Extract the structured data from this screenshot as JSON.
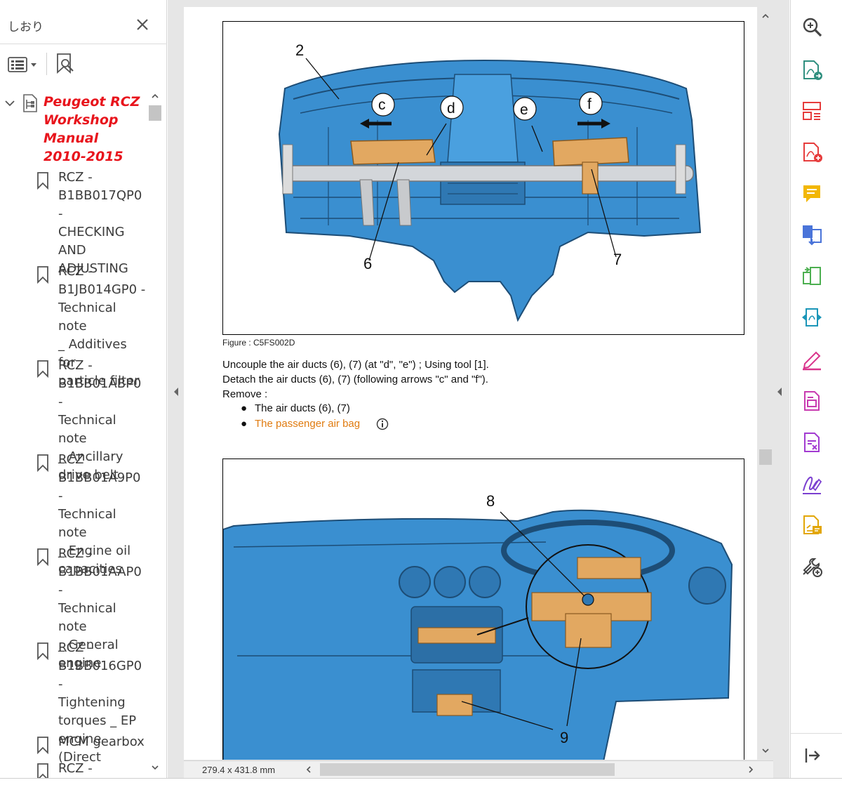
{
  "bookmarks_panel": {
    "title": "しおり",
    "root": {
      "label": "Peugeot RCZ\nWorkshop\nManual\n2010-2015"
    },
    "items": [
      {
        "label": "RCZ -\nB1BB017QP0 -\nCHECKING\nAND\nADJUSTING"
      },
      {
        "label": "RCZ -\nB1JB014GP0 -\nTechnical note\n_ Additives for\nparticle filter"
      },
      {
        "label": "RCZ -\nB1BB01ABP0 -\nTechnical note\n_ Ancillary\ndrive belt"
      },
      {
        "label": "RCZ -\nB1BB01A9P0 -\nTechnical note\n_ Engine oil\ncapacities"
      },
      {
        "label": "RCZ -\nB1BB01AAP0 -\nTechnical note\n_ General\nengine"
      },
      {
        "label": "RCZ -\nB1BB016GP0 -\nTightening\ntorques _ EP\nengine (Direct"
      },
      {
        "label": "MCM gearbox"
      },
      {
        "label": "RCZ -"
      }
    ]
  },
  "document": {
    "figure1": {
      "caption": "Figure : C5FS002D",
      "labels": [
        "2",
        "c",
        "d",
        "e",
        "f",
        "6",
        "7"
      ]
    },
    "instructions": [
      "Uncouple the air ducts (6), (7) (at \"d\", \"e\") ; Using tool [1].",
      "Detach the air ducts (6), (7) (following arrows \"c\" and \"f\").",
      "Remove :"
    ],
    "bullets": [
      {
        "text": "The air ducts (6), (7)"
      },
      {
        "text": "The passenger air bag",
        "link": true
      }
    ],
    "figure2": {
      "labels": [
        "8",
        "9"
      ]
    },
    "page_size": "279.4 x 431.8 mm"
  },
  "tools_panel": {
    "icons": [
      "zoom-icon",
      "export-pdf-icon",
      "organize-pages-icon",
      "create-pdf-icon",
      "comment-icon",
      "combine-files-icon",
      "compress-pdf-icon",
      "send-for-review-icon",
      "fill-sign-icon",
      "edit-pdf-icon",
      "protect-pdf-icon",
      "sign-icon",
      "send-file-icon",
      "more-tools-icon"
    ]
  },
  "colors": {
    "bookmark_root": "#e8141c",
    "link": "#e07b10",
    "part_blue": "#3a8fd0",
    "part_orange": "#e2a861"
  }
}
